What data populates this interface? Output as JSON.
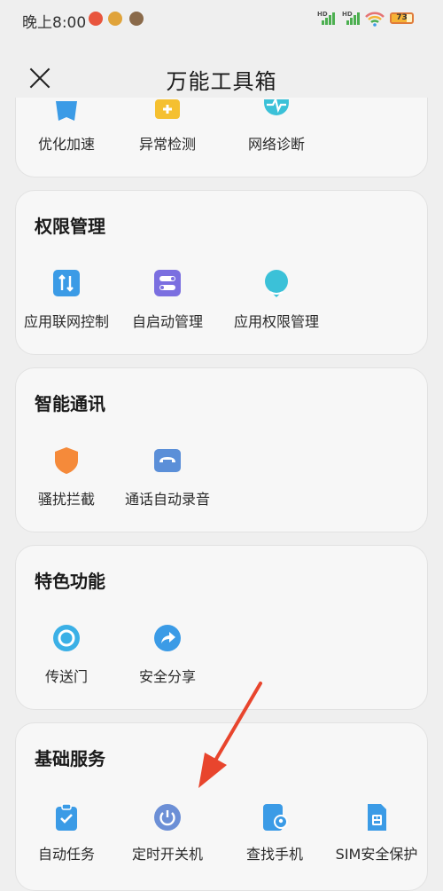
{
  "status_bar": {
    "time": "晚上8:00",
    "signal1_hd": "HD",
    "signal2_hd": "HD",
    "battery": "73"
  },
  "header": {
    "title": "万能工具箱"
  },
  "cards": {
    "top": {
      "items": [
        "优化加速",
        "异常检测",
        "网络诊断"
      ]
    },
    "permission": {
      "title": "权限管理",
      "items": [
        "应用联网控制",
        "自启动管理",
        "应用权限管理"
      ]
    },
    "smart_comm": {
      "title": "智能通讯",
      "items": [
        "骚扰拦截",
        "通话自动录音"
      ]
    },
    "features": {
      "title": "特色功能",
      "items": [
        "传送门",
        "安全分享"
      ]
    },
    "basic": {
      "title": "基础服务",
      "items": [
        "自动任务",
        "定时开关机",
        "查找手机",
        "SIM安全保护"
      ]
    }
  },
  "colors": {
    "accent_blue": "#3b9be6",
    "shield_orange": "#f58a3a",
    "purple": "#7b6fe0",
    "annotation_red": "#e8452d"
  }
}
